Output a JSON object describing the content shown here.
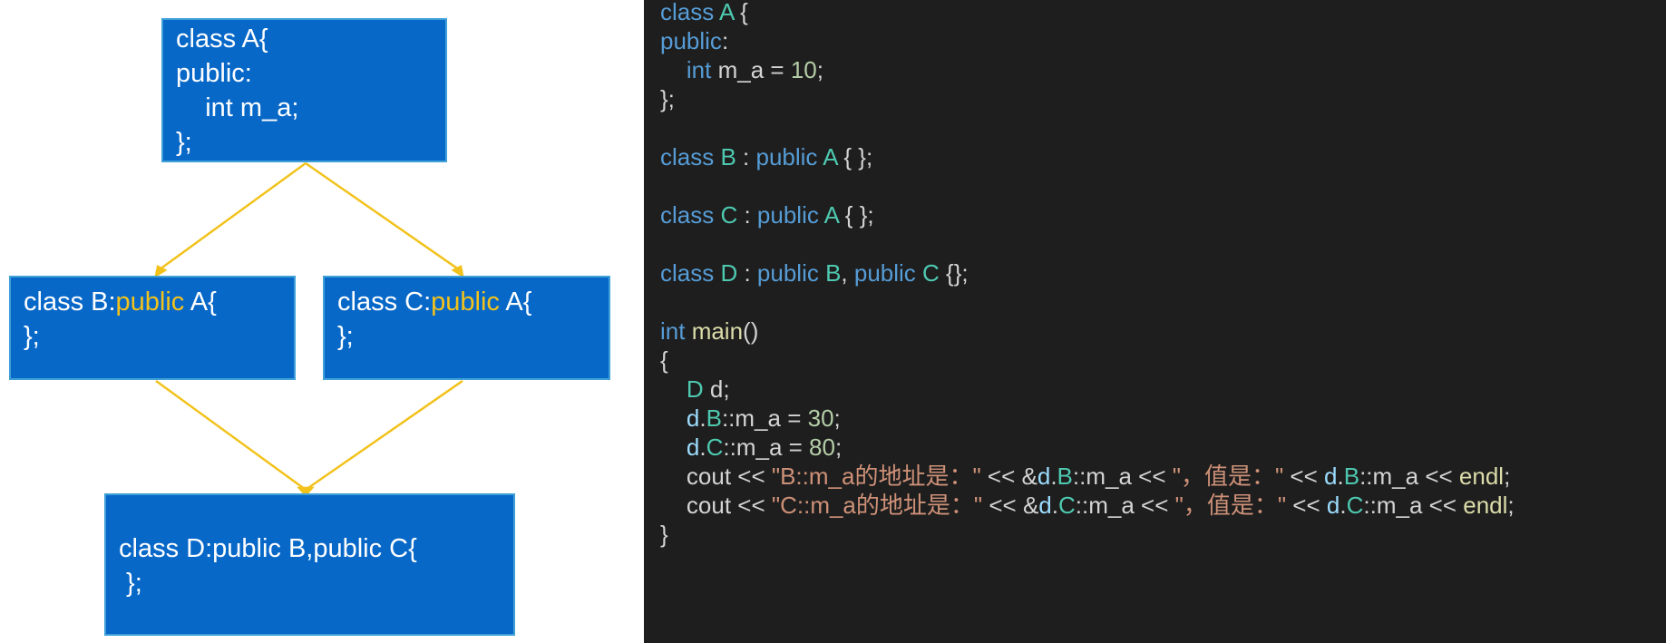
{
  "colors": {
    "box_fill": "#0868c8",
    "box_border": "#3fa0d8",
    "arrow": "#f2c21b",
    "highlight": "#f2c21b",
    "editor_bg": "#1e1e1e"
  },
  "diagram": {
    "boxA": {
      "lines": [
        "class A{",
        "public:",
        "    int m_a;",
        "};"
      ]
    },
    "boxB": {
      "line1_pre": "class B:",
      "line1_kw": "public",
      "line1_post": " A{",
      "line2": "};"
    },
    "boxC": {
      "line1_pre": "class C:",
      "line1_kw": "public",
      "line1_post": " A{",
      "line2": "};"
    },
    "boxD": {
      "lines": [
        "class D:public B,public C{",
        " };"
      ]
    },
    "edges": [
      {
        "from": "A",
        "to": "B"
      },
      {
        "from": "A",
        "to": "C"
      },
      {
        "from": "B",
        "to": "D"
      },
      {
        "from": "C",
        "to": "D"
      }
    ]
  },
  "code": {
    "lines": [
      [
        [
          "keyword",
          "class "
        ],
        [
          "type",
          "A"
        ],
        [
          "plain",
          " {"
        ]
      ],
      [
        [
          "keyword",
          "public"
        ],
        [
          "plain",
          ":"
        ]
      ],
      [
        [
          "plain",
          "    "
        ],
        [
          "keyword",
          "int "
        ],
        [
          "plain",
          "m_a = "
        ],
        [
          "number",
          "10"
        ],
        [
          "plain",
          ";"
        ]
      ],
      [
        [
          "plain",
          "};"
        ]
      ],
      [],
      [
        [
          "keyword",
          "class "
        ],
        [
          "type",
          "B"
        ],
        [
          "plain",
          " : "
        ],
        [
          "keyword",
          "public "
        ],
        [
          "type",
          "A"
        ],
        [
          "plain",
          " { };"
        ]
      ],
      [],
      [
        [
          "keyword",
          "class "
        ],
        [
          "type",
          "C"
        ],
        [
          "plain",
          " : "
        ],
        [
          "keyword",
          "public "
        ],
        [
          "type",
          "A"
        ],
        [
          "plain",
          " { };"
        ]
      ],
      [],
      [
        [
          "keyword",
          "class "
        ],
        [
          "type",
          "D"
        ],
        [
          "plain",
          " : "
        ],
        [
          "keyword",
          "public "
        ],
        [
          "type",
          "B"
        ],
        [
          "plain",
          ", "
        ],
        [
          "keyword",
          "public "
        ],
        [
          "type",
          "C"
        ],
        [
          "plain",
          " {};"
        ]
      ],
      [],
      [
        [
          "keyword",
          "int "
        ],
        [
          "func",
          "main"
        ],
        [
          "plain",
          "()"
        ]
      ],
      [
        [
          "plain",
          "{"
        ]
      ],
      [
        [
          "plain",
          "    "
        ],
        [
          "type",
          "D"
        ],
        [
          "plain",
          " d;"
        ]
      ],
      [
        [
          "plain",
          "    "
        ],
        [
          "var",
          "d"
        ],
        [
          "plain",
          "."
        ],
        [
          "type",
          "B"
        ],
        [
          "plain",
          "::m_a = "
        ],
        [
          "number",
          "30"
        ],
        [
          "plain",
          ";"
        ]
      ],
      [
        [
          "plain",
          "    "
        ],
        [
          "var",
          "d"
        ],
        [
          "plain",
          "."
        ],
        [
          "type",
          "C"
        ],
        [
          "plain",
          "::m_a = "
        ],
        [
          "number",
          "80"
        ],
        [
          "plain",
          ";"
        ]
      ],
      [
        [
          "plain",
          "    cout << "
        ],
        [
          "string",
          "\"B::m_a的地址是：\""
        ],
        [
          "plain",
          " << &"
        ],
        [
          "var",
          "d"
        ],
        [
          "plain",
          "."
        ],
        [
          "type",
          "B"
        ],
        [
          "plain",
          "::m_a << "
        ],
        [
          "string",
          "\"，值是：\""
        ],
        [
          "plain",
          " << "
        ],
        [
          "var",
          "d"
        ],
        [
          "plain",
          "."
        ],
        [
          "type",
          "B"
        ],
        [
          "plain",
          "::m_a << "
        ],
        [
          "func",
          "endl"
        ],
        [
          "plain",
          ";"
        ]
      ],
      [
        [
          "plain",
          "    cout << "
        ],
        [
          "string",
          "\"C::m_a的地址是：\""
        ],
        [
          "plain",
          " << &"
        ],
        [
          "var",
          "d"
        ],
        [
          "plain",
          "."
        ],
        [
          "type",
          "C"
        ],
        [
          "plain",
          "::m_a << "
        ],
        [
          "string",
          "\"，值是：\""
        ],
        [
          "plain",
          " << "
        ],
        [
          "var",
          "d"
        ],
        [
          "plain",
          "."
        ],
        [
          "type",
          "C"
        ],
        [
          "plain",
          "::m_a << "
        ],
        [
          "func",
          "endl"
        ],
        [
          "plain",
          ";"
        ]
      ],
      [
        [
          "plain",
          "}"
        ]
      ]
    ]
  }
}
